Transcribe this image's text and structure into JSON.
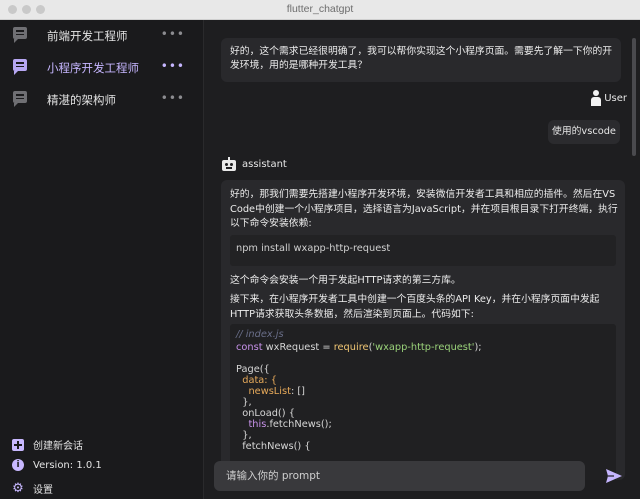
{
  "window": {
    "title": "flutter_chatgpt"
  },
  "sidebar": {
    "items": [
      {
        "label": "前端开发工程师",
        "active": false
      },
      {
        "label": "小程序开发工程师",
        "active": true
      },
      {
        "label": "精湛的架构师",
        "active": false
      }
    ],
    "more_glyph": "•••",
    "new_chat_label": "创建新会话",
    "version_label": "Version: 1.0.1",
    "settings_label": "设置"
  },
  "chat": {
    "first_message": "好的，这个需求已经很明确了，我可以帮你实现这个小程序页面。需要先了解一下你的开发环境，用的是哪种开发工具？",
    "user_tag": "User",
    "user_message": "使用的vscode",
    "assistant_tag": "assistant",
    "assistant_p1": "好的，那我们需要先搭建小程序开发环境，安装微信开发者工具和相应的插件。然后在VS Code中创建一个小程序项目，选择语言为JavaScript，并在项目根目录下打开终端，执行以下命令安装依赖:",
    "command": "npm install wxapp-http-request",
    "assistant_p2": "这个命令会安装一个用于发起HTTP请求的第三方库。",
    "assistant_p3": "接下来，在小程序开发者工具中创建一个百度头条的API Key，并在小程序页面中发起HTTP请求获取头条数据，然后渲染到页面上。代码如下:",
    "code": {
      "comment": "// index.js",
      "l1_kw": "const",
      "l1_var": " wxRequest = ",
      "l1_fn": "require",
      "l1_open": "(",
      "l1_str": "'wxapp-http-request'",
      "l1_close": ");",
      "l2": "Page({",
      "l3": "  data: {",
      "l4_prop": "    newsList",
      "l4_rest": ": []",
      "l5": "  },",
      "l6": "  onLoad() {",
      "l7_kw": "    this",
      "l7_rest": ".fetchNews();",
      "l8": "  },",
      "l9": "  fetchNews() {"
    }
  },
  "input": {
    "placeholder": "请输入你的 prompt",
    "value": ""
  },
  "colors": {
    "accent": "#c6b6ff",
    "background": "#1e1e20",
    "bubble": "#29292c"
  }
}
